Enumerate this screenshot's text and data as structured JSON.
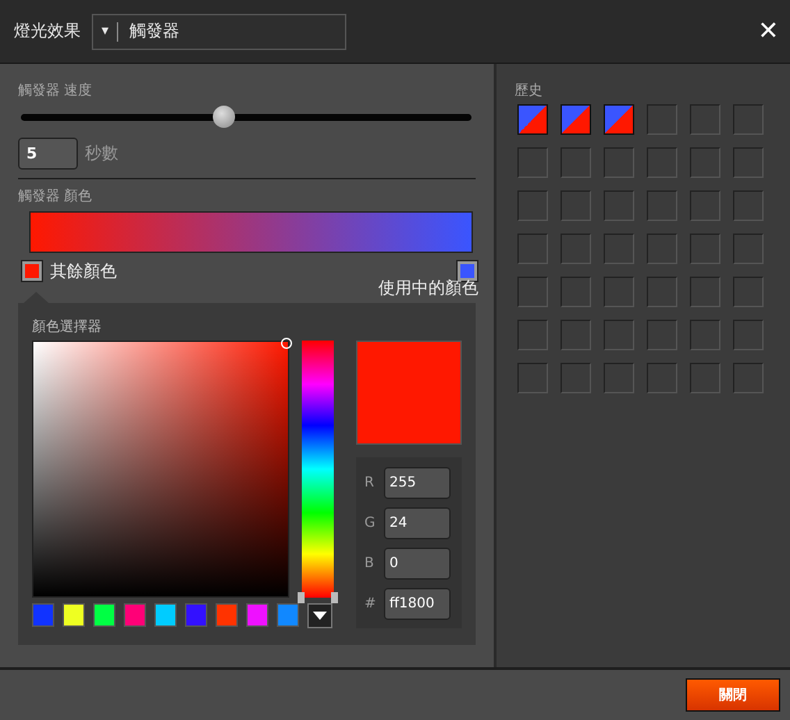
{
  "header": {
    "title": "燈光效果",
    "dropdown": {
      "value": "觸發器",
      "caret": "▾"
    },
    "close": "✕"
  },
  "speed": {
    "label": "觸發器 速度",
    "level": 0.45,
    "seconds": {
      "value": "5",
      "unit": "秒數"
    }
  },
  "gradient": {
    "label": "觸發器 顏色",
    "stops": [
      {
        "label": "其餘顏色",
        "color": "#ff1800"
      },
      {
        "label": "使用中的顏色",
        "color": "#3a55ff"
      }
    ]
  },
  "picker": {
    "title": "顏色選擇器",
    "hue": {
      "level": 0
    },
    "swatches": [
      {
        "color": "#1133ff"
      },
      {
        "color": "#eeff22"
      },
      {
        "color": "#00ff44"
      },
      {
        "color": "#ff0077"
      },
      {
        "color": "#00ccff"
      },
      {
        "color": "#3311ff"
      },
      {
        "color": "#ff3300"
      },
      {
        "color": "#ee11ff"
      },
      {
        "color": "#1188ff"
      }
    ],
    "preview": {
      "color": "#ff1800"
    },
    "fields": [
      {
        "label": "R",
        "value": "255"
      },
      {
        "label": "G",
        "value": "24"
      },
      {
        "label": "B",
        "value": "0"
      },
      {
        "label": "#",
        "value": "ff1800"
      }
    ]
  },
  "history": {
    "label": "歷史",
    "cells": [
      {
        "filled": true
      },
      {
        "filled": true
      },
      {
        "filled": true
      },
      {
        "filled": false
      },
      {
        "filled": false
      },
      {
        "filled": false
      },
      {
        "filled": false
      },
      {
        "filled": false
      },
      {
        "filled": false
      },
      {
        "filled": false
      },
      {
        "filled": false
      },
      {
        "filled": false
      },
      {
        "filled": false
      },
      {
        "filled": false
      },
      {
        "filled": false
      },
      {
        "filled": false
      },
      {
        "filled": false
      },
      {
        "filled": false
      },
      {
        "filled": false
      },
      {
        "filled": false
      },
      {
        "filled": false
      },
      {
        "filled": false
      },
      {
        "filled": false
      },
      {
        "filled": false
      },
      {
        "filled": false
      },
      {
        "filled": false
      },
      {
        "filled": false
      },
      {
        "filled": false
      },
      {
        "filled": false
      },
      {
        "filled": false
      },
      {
        "filled": false
      },
      {
        "filled": false
      },
      {
        "filled": false
      },
      {
        "filled": false
      },
      {
        "filled": false
      },
      {
        "filled": false
      },
      {
        "filled": false
      },
      {
        "filled": false
      },
      {
        "filled": false
      },
      {
        "filled": false
      },
      {
        "filled": false
      },
      {
        "filled": false
      }
    ]
  },
  "footer": {
    "button": "關閉"
  }
}
